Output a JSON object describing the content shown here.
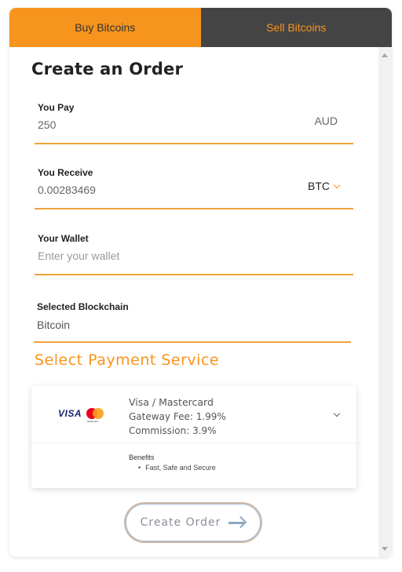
{
  "tabs": {
    "buy": "Buy Bitcoins",
    "sell": "Sell Bitcoins",
    "active": "buy"
  },
  "form": {
    "title": "Create an Order",
    "you_pay": {
      "label": "You Pay",
      "value": "250",
      "currency": "AUD"
    },
    "you_receive": {
      "label": "You Receive",
      "value": "0.00283469",
      "currency": "BTC"
    },
    "wallet": {
      "label": "Your Wallet",
      "placeholder": "Enter your wallet",
      "value": ""
    },
    "blockchain": {
      "label": "Selected Blockchain",
      "value": "Bitcoin"
    }
  },
  "payment": {
    "section_title": "Select Payment Service",
    "service": {
      "name": "Visa / Mastercard",
      "gateway_fee": "Gateway Fee: 1.99%",
      "commission": "Commission: 3.9%",
      "logo_visa": "VISA",
      "logo_mc": "mastercard",
      "benefits_title": "Benefits",
      "benefits": [
        "Fast, Safe and Secure"
      ]
    }
  },
  "actions": {
    "create_order": "Create Order"
  },
  "colors": {
    "accent": "#f7941d",
    "dark_tab": "#444444",
    "underline": "#f0a23c"
  },
  "icons": [
    "chevron-down-icon",
    "arrow-right-icon",
    "visa-logo",
    "mastercard-logo"
  ]
}
